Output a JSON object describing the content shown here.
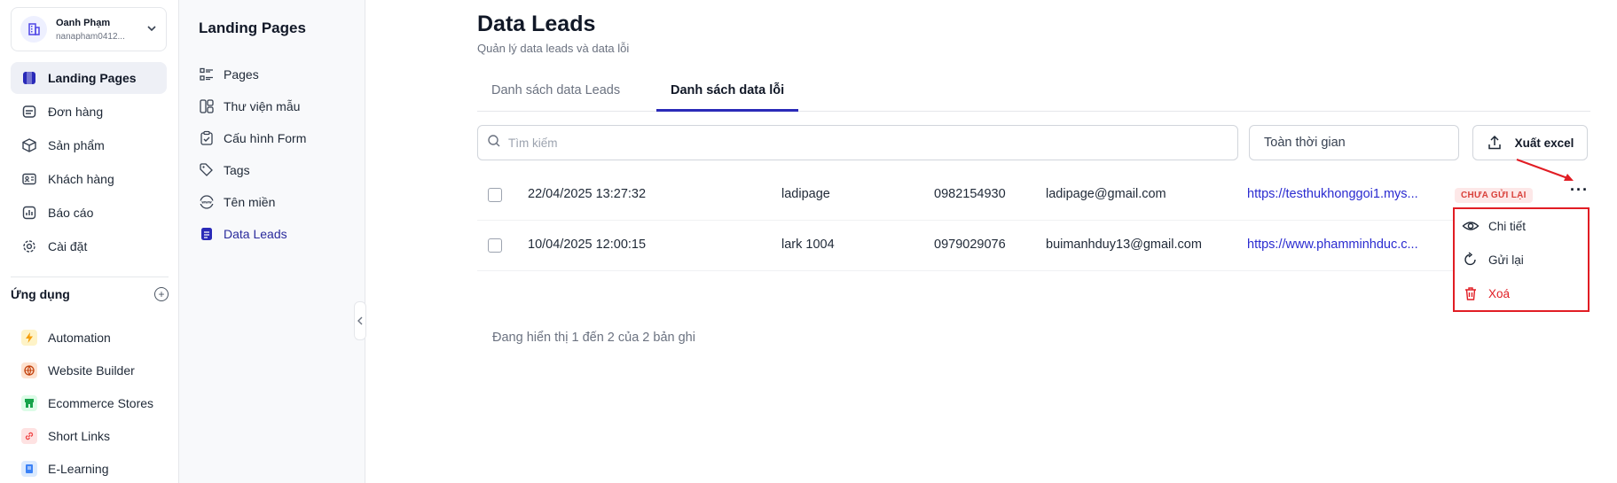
{
  "account": {
    "name": "Oanh Phạm",
    "email": "nanapham0412..."
  },
  "nav": [
    {
      "label": "Landing Pages",
      "icon": "landing-pages-icon",
      "active": true
    },
    {
      "label": "Đơn hàng",
      "icon": "orders-icon"
    },
    {
      "label": "Sản phẩm",
      "icon": "box-icon"
    },
    {
      "label": "Khách hàng",
      "icon": "contact-card-icon"
    },
    {
      "label": "Báo cáo",
      "icon": "report-icon"
    },
    {
      "label": "Cài đặt",
      "icon": "gear-icon"
    }
  ],
  "apps": {
    "title": "Ứng dụng",
    "items": [
      {
        "label": "Automation",
        "icon": "bolt-icon",
        "color": "#f59e0b"
      },
      {
        "label": "Website Builder",
        "icon": "globe-icon",
        "color": "#c2410c"
      },
      {
        "label": "Ecommerce Stores",
        "icon": "store-icon",
        "color": "#16a34a"
      },
      {
        "label": "Short Links",
        "icon": "link-icon",
        "color": "#ef4444"
      },
      {
        "label": "E-Learning",
        "icon": "book-icon",
        "color": "#3b82f6"
      }
    ]
  },
  "subnav": {
    "title": "Landing Pages",
    "items": [
      {
        "label": "Pages",
        "icon": "list-icon"
      },
      {
        "label": "Thư viện mẫu",
        "icon": "template-icon"
      },
      {
        "label": "Cấu hình Form",
        "icon": "clipboard-check-icon"
      },
      {
        "label": "Tags",
        "icon": "tags-icon"
      },
      {
        "label": "Tên miền",
        "icon": "www-icon"
      },
      {
        "label": "Data Leads",
        "icon": "document-icon",
        "active": true
      }
    ]
  },
  "main": {
    "title": "Data Leads",
    "subtitle": "Quản lý data leads và data lỗi",
    "tabs": [
      {
        "label": "Danh sách data Leads",
        "active": false
      },
      {
        "label": "Danh sách data lỗi",
        "active": true
      }
    ],
    "search_placeholder": "Tìm kiếm",
    "time_filter": "Toàn thời gian",
    "export_label": "Xuất excel",
    "rows": [
      {
        "date": "22/04/2025 13:27:32",
        "source": "ladipage",
        "phone": "0982154930",
        "email": "ladipage@gmail.com",
        "url": "https://testhukhonggoi1.mys...",
        "badge": "CHƯA GỬI LẠI"
      },
      {
        "date": "10/04/2025 12:00:15",
        "source": "lark 1004",
        "phone": "0979029076",
        "email": "buimanhduy13@gmail.com",
        "url": "https://www.phamminhduc.c..."
      }
    ],
    "pagination": "Đang hiển thị 1 đến 2 của 2 bản ghi",
    "context_menu": [
      {
        "label": "Chi tiết",
        "icon": "eye-icon"
      },
      {
        "label": "Gửi lại",
        "icon": "refresh-icon"
      },
      {
        "label": "Xoá",
        "icon": "trash-icon",
        "danger": true
      }
    ]
  },
  "colors": {
    "accent": "#2a2ab8",
    "danger": "#e11d24",
    "link": "#2a2bd0"
  }
}
